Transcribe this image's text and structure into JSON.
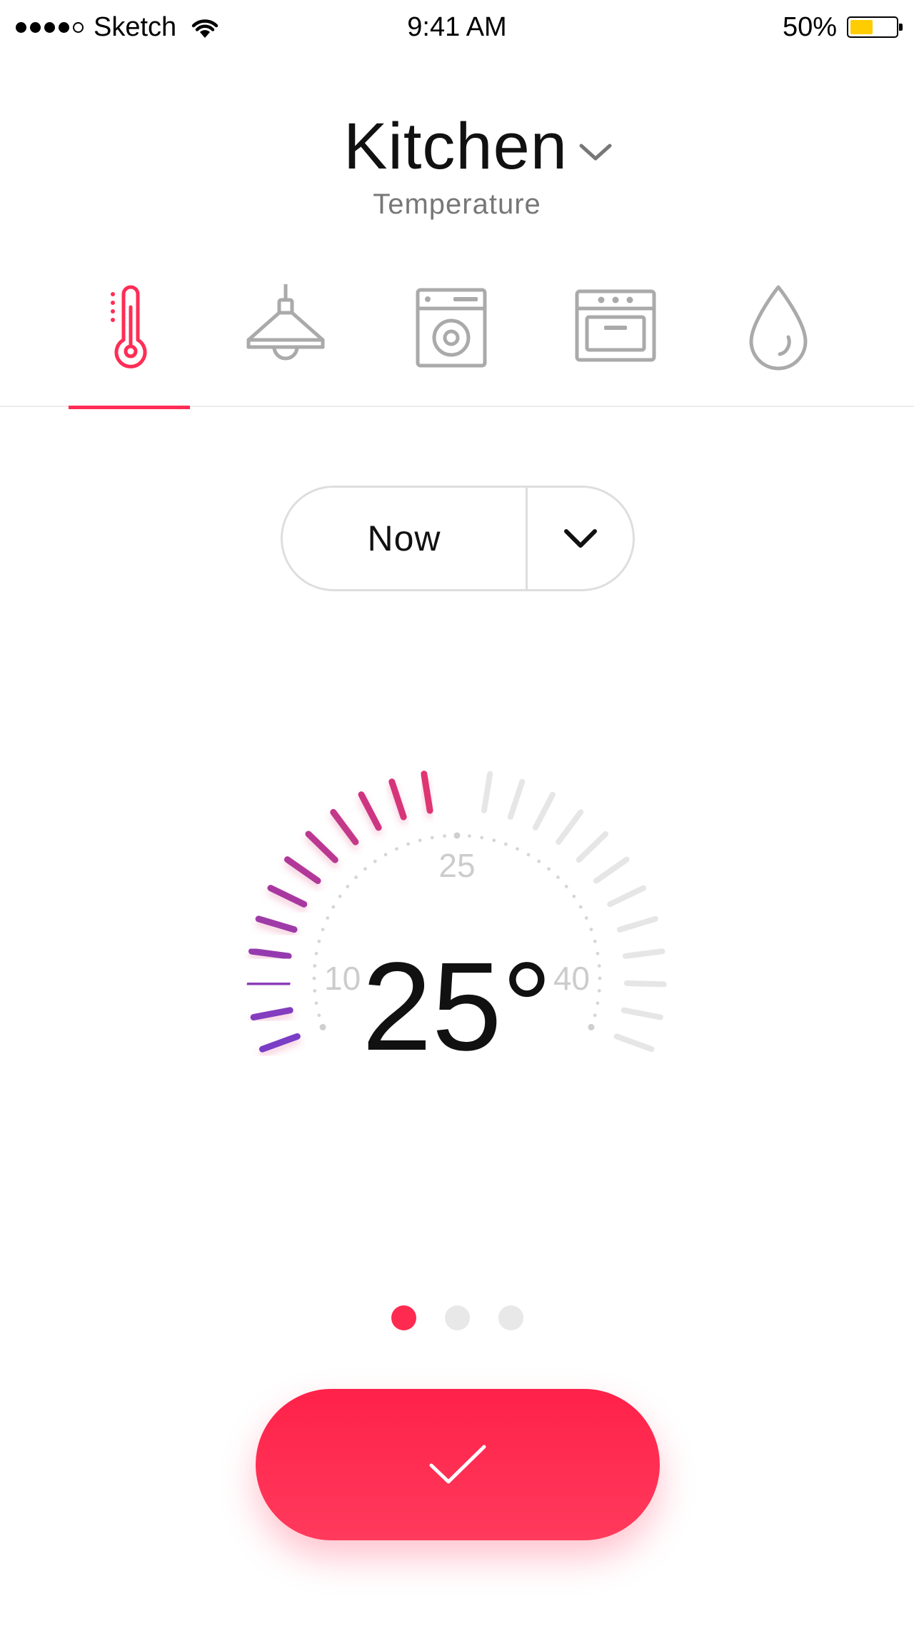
{
  "status_bar": {
    "carrier": "Sketch",
    "time": "9:41 AM",
    "battery": "50%",
    "battery_level": 0.5,
    "battery_color": "#ffcc00",
    "signal_bars_filled": 4,
    "signal_bars_total": 5
  },
  "header": {
    "room": "Kitchen",
    "subtitle": "Temperature"
  },
  "tabs": [
    {
      "id": "thermometer",
      "icon": "thermometer-icon",
      "active": true
    },
    {
      "id": "lamp",
      "icon": "lamp-icon",
      "active": false
    },
    {
      "id": "washer",
      "icon": "washing-machine-icon",
      "active": false
    },
    {
      "id": "oven",
      "icon": "oven-icon",
      "active": false
    },
    {
      "id": "humidity",
      "icon": "water-drop-icon",
      "active": false
    }
  ],
  "period_selector": {
    "value": "Now"
  },
  "thermostat": {
    "min": 10,
    "max": 40,
    "value": 25,
    "readout": "25°",
    "labels": {
      "min": "10",
      "mid": "25",
      "max": "40"
    },
    "active_colors": [
      "#7a3ec6",
      "#e8336b"
    ],
    "inactive_color": "#e6e6e6",
    "tick_count": 25
  },
  "pagination": {
    "count": 3,
    "active_index": 0
  },
  "confirm_button": {
    "icon": "checkmark-icon",
    "color": "#ff2a4f"
  },
  "accent_color": "#ff2d55"
}
